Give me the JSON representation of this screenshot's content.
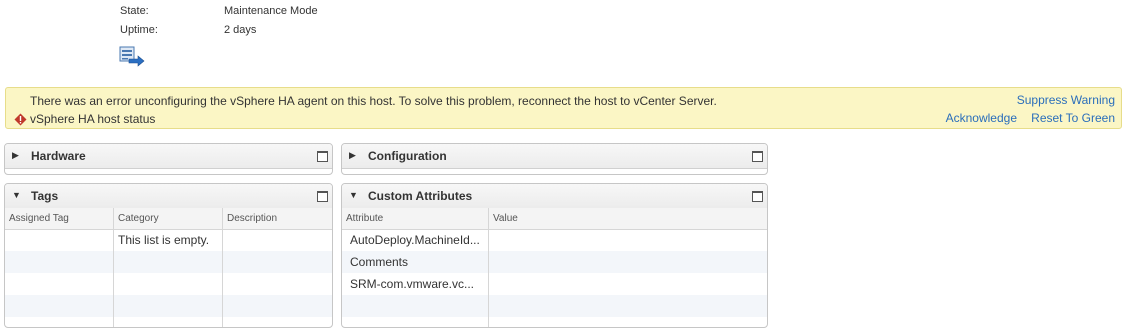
{
  "summary": {
    "state_label": "State:",
    "state_value": "Maintenance Mode",
    "uptime_label": "Uptime:",
    "uptime_value": "2 days",
    "host_icon": "host-migrate-icon"
  },
  "alert": {
    "message": "There was an error unconfiguring the vSphere HA agent on this host. To solve this problem, reconnect the host to vCenter Server.",
    "status": "vSphere HA host status",
    "icon": "error-icon",
    "actions": {
      "suppress": "Suppress Warning",
      "acknowledge": "Acknowledge",
      "reset": "Reset To Green"
    },
    "colors": {
      "background": "#fbf6c5",
      "link": "#2a6ebb",
      "error": "#c0392b"
    }
  },
  "portlets": {
    "hardware": {
      "title": "Hardware",
      "expanded": false
    },
    "configuration": {
      "title": "Configuration",
      "expanded": false
    },
    "tags": {
      "title": "Tags",
      "expanded": true,
      "columns": [
        "Assigned Tag",
        "Category",
        "Description"
      ],
      "empty_text": "This list is empty."
    },
    "custom_attributes": {
      "title": "Custom Attributes",
      "expanded": true,
      "columns": [
        "Attribute",
        "Value"
      ],
      "rows": [
        {
          "attribute": "AutoDeploy.MachineId...",
          "value": ""
        },
        {
          "attribute": "Comments",
          "value": ""
        },
        {
          "attribute": "SRM-com.vmware.vc...",
          "value": ""
        }
      ]
    }
  }
}
